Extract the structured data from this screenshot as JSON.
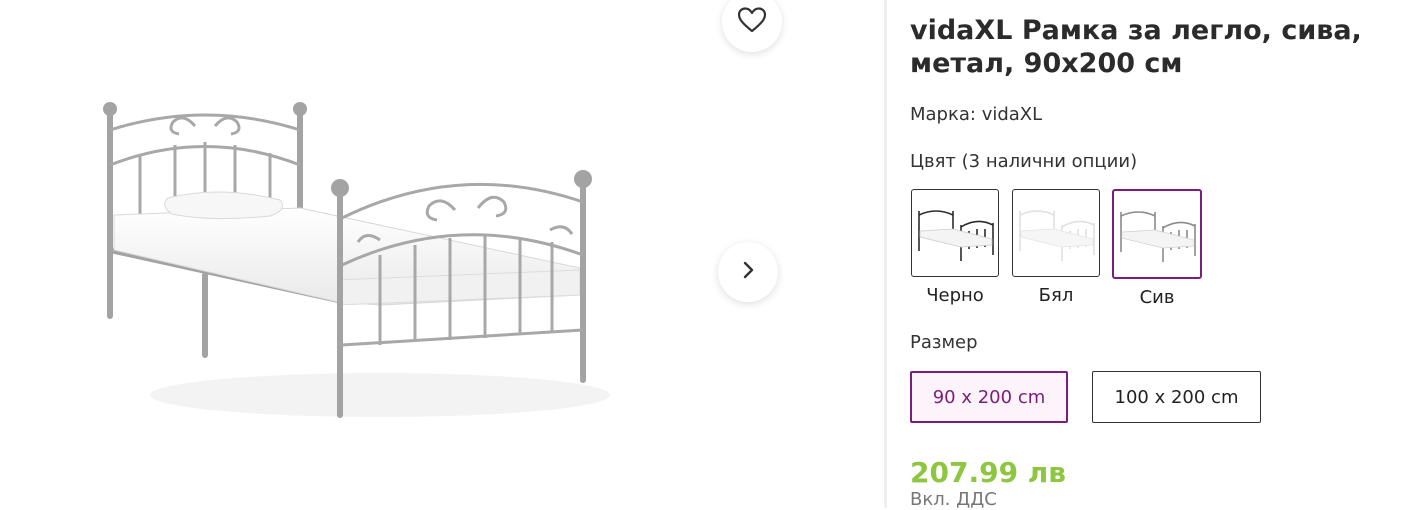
{
  "product": {
    "title": "vidaXL Рамка за легло, сива, метал, 90x200 см",
    "brand_label": "Марка:",
    "brand_value": "vidaXL",
    "color_heading": "Цвят (3 налични опции)",
    "colors": [
      {
        "label": "Черно",
        "frame_color": "#2b2b2b",
        "selected": false
      },
      {
        "label": "Бял",
        "frame_color": "#e6e6e6",
        "selected": false
      },
      {
        "label": "Сив",
        "frame_color": "#8a8a8a",
        "selected": true
      }
    ],
    "size_heading": "Размер",
    "sizes": [
      {
        "label": "90 x 200 cm",
        "selected": true
      },
      {
        "label": "100 x 200 cm",
        "selected": false
      }
    ],
    "price": "207.99 лв",
    "vat_note": "Вкл. ДДС"
  },
  "gallery": {
    "favorite_icon": "heart-icon",
    "next_icon": "chevron-right-icon"
  },
  "colors": {
    "accent": "#7b1d7b",
    "price": "#8dc63f",
    "frame_gray": "#a3a3a3"
  }
}
